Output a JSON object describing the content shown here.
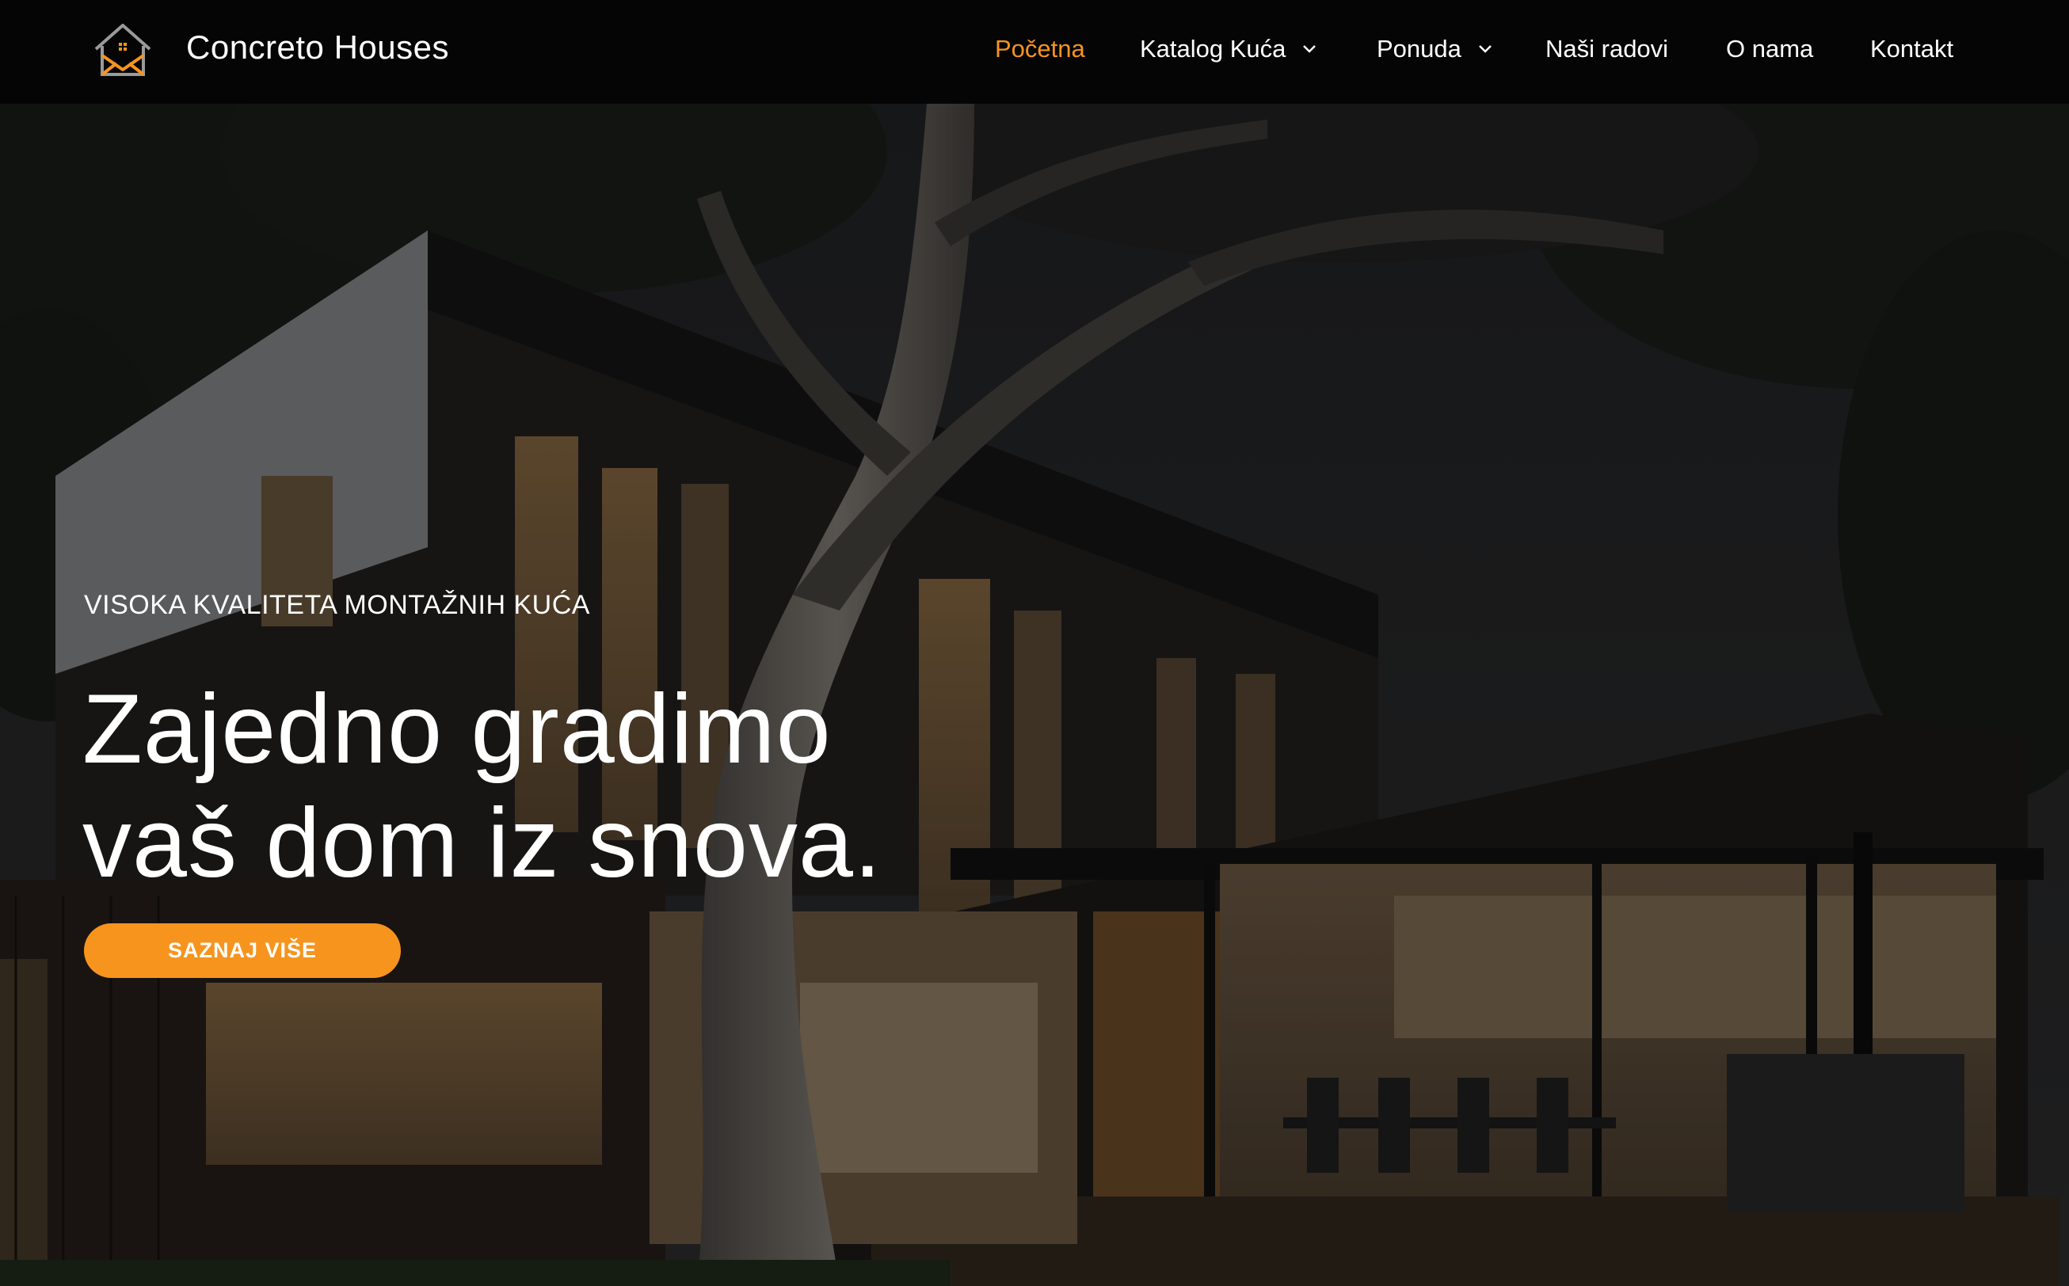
{
  "header": {
    "brand": "Concreto Houses",
    "logo_icon": "house-logo-icon",
    "accent_color": "#f7941d"
  },
  "nav": {
    "items": [
      {
        "label": "Početna",
        "active": true,
        "has_dropdown": false
      },
      {
        "label": "Katalog Kuća",
        "active": false,
        "has_dropdown": true
      },
      {
        "label": "Ponuda",
        "active": false,
        "has_dropdown": true
      },
      {
        "label": "Naši radovi",
        "active": false,
        "has_dropdown": false
      },
      {
        "label": "O nama",
        "active": false,
        "has_dropdown": false
      },
      {
        "label": "Kontakt",
        "active": false,
        "has_dropdown": false
      }
    ]
  },
  "hero": {
    "eyebrow": "VISOKA KVALITETA MONTAŽNIH KUĆA",
    "headline_line1": "Zajedno gradimo",
    "headline_line2": "vaš dom iz snova.",
    "cta_label": "SAZNAJ VIŠE",
    "cta_color": "#f7941d"
  }
}
